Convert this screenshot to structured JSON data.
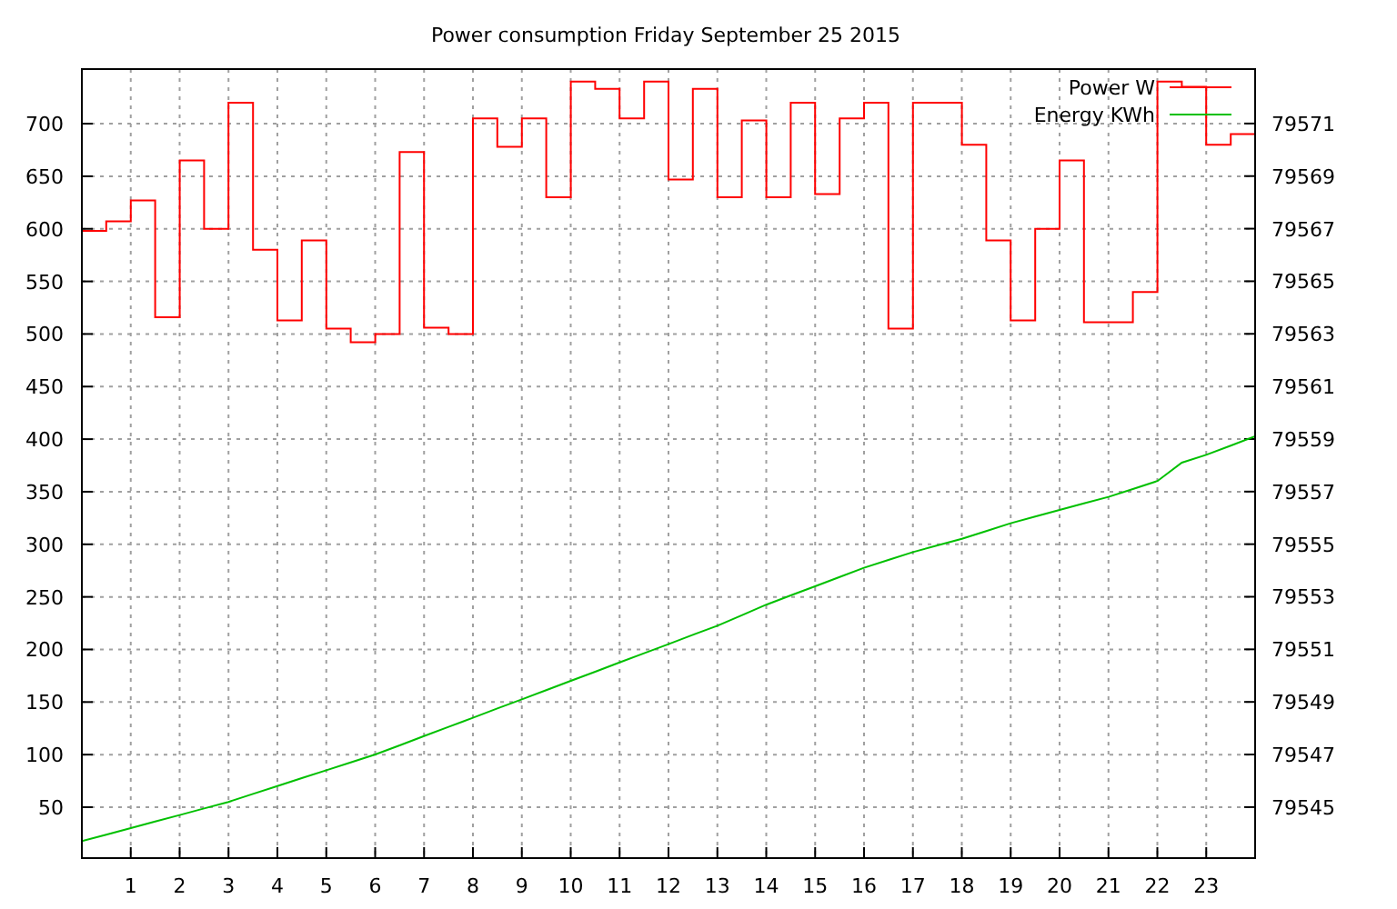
{
  "plot": {
    "chart_data": {
      "type": "line",
      "title": "Power consumption Friday September 25 2015",
      "x": [
        0,
        0.5,
        0.5,
        1,
        1,
        1.5,
        1.5,
        2,
        2,
        2.5,
        2.5,
        3,
        3,
        3.5,
        3.5,
        4,
        4,
        4.5,
        4.5,
        5,
        5,
        5.5,
        5.5,
        6,
        6,
        6.5,
        6.5,
        7,
        7,
        7.5,
        7.5,
        8,
        8,
        8.5,
        8.5,
        9,
        9,
        9.5,
        9.5,
        10,
        10,
        10.5,
        10.5,
        11,
        11,
        11.5,
        11.5,
        12,
        12,
        12.5,
        12.5,
        13,
        13,
        13.5,
        13.5,
        14,
        14,
        14.5,
        14.5,
        15,
        15,
        15.5,
        15.5,
        16,
        16,
        16.5,
        16.5,
        17,
        17,
        17.5,
        17.5,
        18,
        18,
        18.5,
        18.5,
        19,
        19,
        19.5,
        19.5,
        20,
        20,
        20.5,
        20.5,
        21,
        21,
        21.5,
        21.5,
        22,
        22,
        22.5,
        22.5,
        23,
        23,
        23.5,
        23.5,
        24
      ],
      "series": [
        {
          "name": "Power W",
          "color": "#ff0000",
          "axis": "y",
          "values": [
            598,
            598,
            607,
            607,
            627,
            627,
            516,
            516,
            665,
            665,
            600,
            600,
            720,
            720,
            580,
            580,
            513,
            513,
            589,
            589,
            505,
            505,
            492,
            492,
            500,
            500,
            673,
            673,
            506,
            506,
            500,
            500,
            705,
            705,
            678,
            678,
            705,
            705,
            630,
            630,
            740,
            740,
            733,
            733,
            705,
            705,
            740,
            740,
            647,
            647,
            733,
            733,
            630,
            630,
            703,
            703,
            630,
            630,
            720,
            720,
            633,
            633,
            705,
            705,
            720,
            720,
            505,
            505,
            720,
            720,
            720,
            720,
            680,
            680,
            589,
            589,
            513,
            513,
            600,
            600,
            665,
            665,
            511,
            511,
            511,
            511,
            540,
            540,
            740,
            740,
            735,
            735,
            680,
            680,
            690,
            690
          ]
        },
        {
          "name": "Energy KWh",
          "color": "#00c000",
          "axis": "y2",
          "values": [
            79543.7,
            79543.95,
            79543.95,
            79544.2,
            79544.2,
            79544.45,
            79544.45,
            79544.7,
            79544.7,
            79544.95,
            79544.95,
            79545.2,
            79545.2,
            79545.5,
            79545.5,
            79545.8,
            79545.8,
            79546.1,
            79546.1,
            79546.4,
            79546.4,
            79546.7,
            79546.7,
            79547.0,
            79547.0,
            79547.35,
            79547.35,
            79547.7,
            79547.7,
            79548.05,
            79548.05,
            79548.4,
            79548.4,
            79548.75,
            79548.75,
            79549.1,
            79549.1,
            79549.45,
            79549.45,
            79549.8,
            79549.8,
            79550.15,
            79550.15,
            79550.5,
            79550.5,
            79550.85,
            79550.85,
            79551.2,
            79551.2,
            79551.55,
            79551.55,
            79551.9,
            79551.9,
            79552.3,
            79552.3,
            79552.7,
            79552.7,
            79553.05,
            79553.05,
            79553.4,
            79553.4,
            79553.75,
            79553.75,
            79554.1,
            79554.1,
            79554.4,
            79554.4,
            79554.7,
            79554.7,
            79554.95,
            79554.95,
            79555.2,
            79555.2,
            79555.5,
            79555.5,
            79555.8,
            79555.8,
            79556.05,
            79556.05,
            79556.3,
            79556.3,
            79556.55,
            79556.55,
            79556.8,
            79556.8,
            79557.1,
            79557.1,
            79557.4,
            79557.4,
            79558.1,
            79558.1,
            79558.4,
            79558.4,
            79558.75,
            79558.75,
            79559.1
          ]
        }
      ],
      "xlim": [
        0,
        24
      ],
      "ylim": [
        1.6,
        751.9
      ],
      "y2lim": [
        79543.06,
        79573.07
      ],
      "xticks": [
        1,
        2,
        3,
        4,
        5,
        6,
        7,
        8,
        9,
        10,
        11,
        12,
        13,
        14,
        15,
        16,
        17,
        18,
        19,
        20,
        21,
        22,
        23
      ],
      "yticks": [
        50,
        100,
        150,
        200,
        250,
        300,
        350,
        400,
        450,
        500,
        550,
        600,
        650,
        700
      ],
      "y2ticks": [
        79545,
        79547,
        79549,
        79551,
        79553,
        79555,
        79557,
        79559,
        79561,
        79563,
        79565,
        79567,
        79569,
        79571
      ],
      "grid": true,
      "legend": true
    }
  }
}
